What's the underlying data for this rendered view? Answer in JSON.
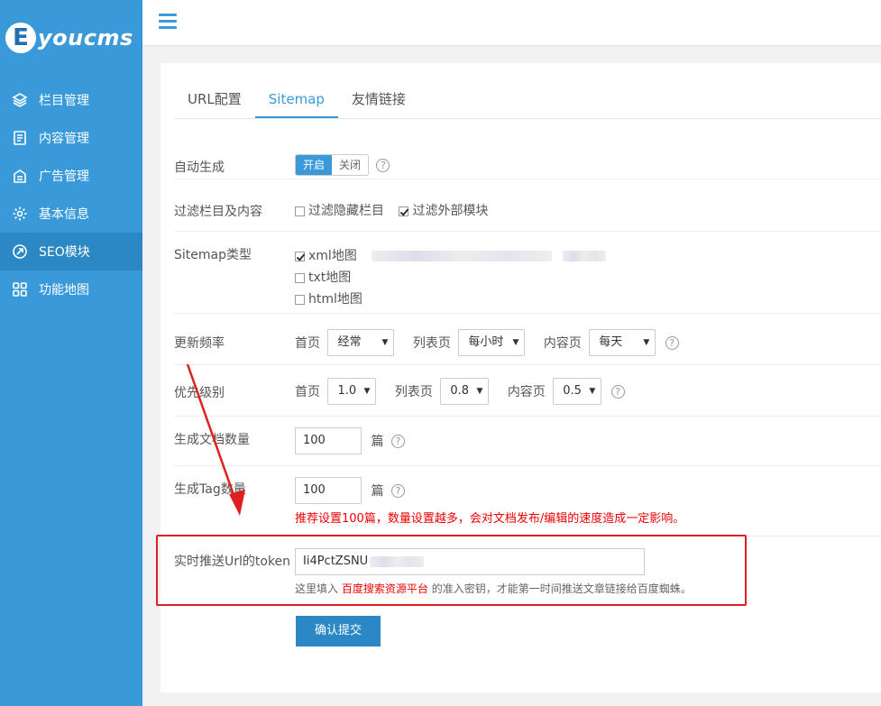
{
  "logo": {
    "badge": "E",
    "text": "youcms"
  },
  "sidebar": {
    "items": [
      {
        "label": "栏目管理",
        "icon": "layers-icon"
      },
      {
        "label": "内容管理",
        "icon": "document-icon"
      },
      {
        "label": "广告管理",
        "icon": "ad-icon"
      },
      {
        "label": "基本信息",
        "icon": "gear-icon"
      },
      {
        "label": "SEO模块",
        "icon": "seo-icon",
        "active": true
      },
      {
        "label": "功能地图",
        "icon": "grid-icon"
      }
    ]
  },
  "tabs": [
    {
      "label": "URL配置"
    },
    {
      "label": "Sitemap",
      "active": true
    },
    {
      "label": "友情链接"
    }
  ],
  "form": {
    "auto_generate": {
      "label": "自动生成",
      "on": "开启",
      "off": "关闭",
      "help": "?"
    },
    "filter": {
      "label": "过滤栏目及内容",
      "opt1": "过滤隐藏栏目",
      "opt2": "过滤外部模块"
    },
    "sitemap_type": {
      "label": "Sitemap类型",
      "xml": "xml地图",
      "txt": "txt地图",
      "html": "html地图"
    },
    "frequency": {
      "label": "更新频率",
      "home_label": "首页",
      "home_value": "经常",
      "list_label": "列表页",
      "list_value": "每小时",
      "content_label": "内容页",
      "content_value": "每天",
      "help": "?"
    },
    "priority": {
      "label": "优先级别",
      "home_label": "首页",
      "home_value": "1.0",
      "list_label": "列表页",
      "list_value": "0.8",
      "content_label": "内容页",
      "content_value": "0.5",
      "help": "?"
    },
    "doc_count": {
      "label": "生成文档数量",
      "value": "100",
      "unit": "篇",
      "help": "?"
    },
    "tag_count": {
      "label": "生成Tag数量",
      "value": "100",
      "unit": "篇",
      "help": "?",
      "warning": "推荐设置100篇，数量设置越多，会对文档发布/编辑的速度造成一定影响。"
    },
    "token": {
      "label": "实时推送Url的token",
      "value": "Ii4PctZSNU",
      "hint_pre": "这里填入",
      "hint_link": "百度搜索资源平台",
      "hint_post": "的准入密钥，才能第一时间推送文章链接给百度蜘蛛。"
    },
    "submit": "确认提交"
  },
  "colors": {
    "primary": "#3a9ad9",
    "annotation": "#e02020"
  }
}
